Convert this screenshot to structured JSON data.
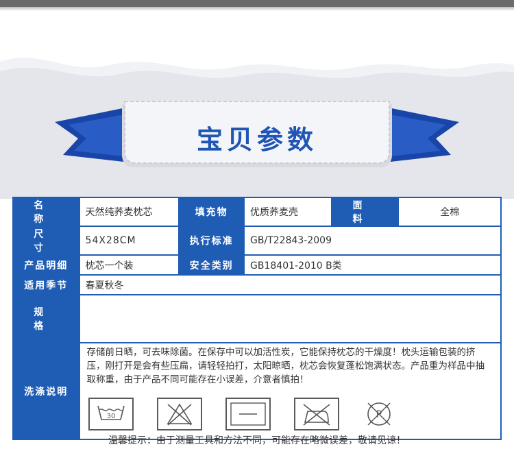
{
  "banner": {
    "title": "宝贝参数"
  },
  "params": {
    "name_label": "名 称",
    "name_value": "天然纯荞麦枕芯",
    "filling_label": "填充物",
    "filling_value": "优质荞麦壳",
    "fabric_label": "面 料",
    "fabric_value": "全棉",
    "size_label": "尺 寸",
    "size_value": "54X28CM",
    "standard_label": "执行标准",
    "standard_value": "GB/T22843-2009",
    "detail_label": "产品明细",
    "detail_value": "枕芯一个装",
    "safety_label": "安全类别",
    "safety_value": "GB18401-2010 B类",
    "season_label": "适用季节",
    "season_value": "春夏秋冬",
    "spec_label": "规 格",
    "spec_value": "",
    "care_label": "洗涤说明",
    "care_text": "存储前日晒，可去味除菌。在保存中可以加活性炭，它能保持枕芯的干燥度！枕头运输包装的挤压，刚打开是会有些压扁，请轻轻拍打，太阳晾晒，枕芯会恢复蓬松饱满状态。产品重为样品中抽取称重，由于产品不同可能存在小误差，介意者慎拍！",
    "wash_temp": "30",
    "dryclean_letter": "P"
  },
  "care_icons": [
    "wash-30-icon",
    "no-bleach-icon",
    "flat-dry-icon",
    "no-iron-icon",
    "dry-clean-p-icon"
  ],
  "footer": {
    "note": "温馨提示：由于测量工具和方法不同，可能存在略微误差，敬请见谅！"
  },
  "colors": {
    "accent": "#1f5db5",
    "banner_dark": "#1a45a8"
  }
}
